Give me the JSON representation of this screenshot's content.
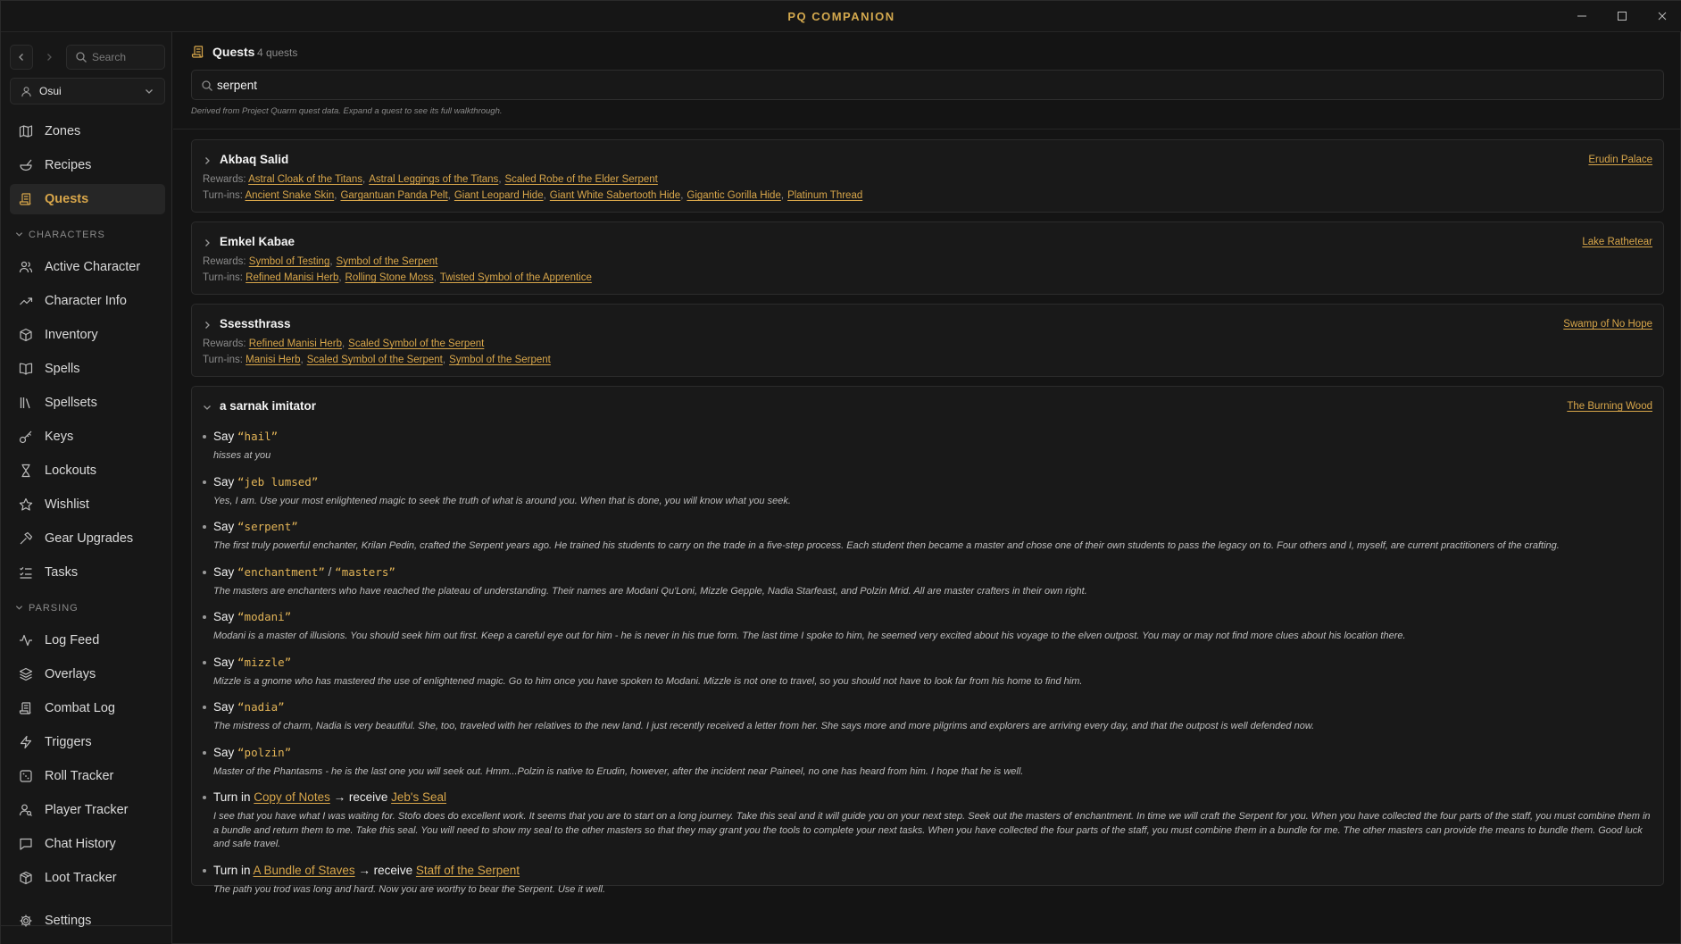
{
  "app": {
    "title": "PQ COMPANION"
  },
  "window_controls": {
    "minimize": "–",
    "maximize": "☐",
    "close": "✕"
  },
  "sidebar": {
    "back": "‹",
    "forward": "›",
    "search_placeholder": "Search",
    "character": "Osui",
    "items": [
      {
        "id": "zones",
        "label": "Zones",
        "icon": "map-icon"
      },
      {
        "id": "recipes",
        "label": "Recipes",
        "icon": "mortar-pestle-icon"
      },
      {
        "id": "quests",
        "label": "Quests",
        "icon": "scroll-icon",
        "active": true
      }
    ],
    "sections": [
      {
        "title": "CHARACTERS",
        "items": [
          {
            "id": "active-character",
            "label": "Active Character",
            "icon": "users-icon"
          },
          {
            "id": "character-info",
            "label": "Character Info",
            "icon": "trending-up-icon"
          },
          {
            "id": "inventory",
            "label": "Inventory",
            "icon": "box-icon"
          },
          {
            "id": "spells",
            "label": "Spells",
            "icon": "book-icon"
          },
          {
            "id": "spellsets",
            "label": "Spellsets",
            "icon": "library-icon"
          },
          {
            "id": "keys",
            "label": "Keys",
            "icon": "key-icon"
          },
          {
            "id": "lockouts",
            "label": "Lockouts",
            "icon": "hourglass-icon"
          },
          {
            "id": "wishlist",
            "label": "Wishlist",
            "icon": "star-icon"
          },
          {
            "id": "gear-upgrades",
            "label": "Gear Upgrades",
            "icon": "hammer-icon"
          },
          {
            "id": "tasks",
            "label": "Tasks",
            "icon": "list-checks-icon"
          }
        ]
      },
      {
        "title": "PARSING",
        "items": [
          {
            "id": "log-feed",
            "label": "Log Feed",
            "icon": "activity-icon"
          },
          {
            "id": "overlays",
            "label": "Overlays",
            "icon": "layers-icon"
          },
          {
            "id": "combat-log",
            "label": "Combat Log",
            "icon": "scroll-icon"
          },
          {
            "id": "triggers",
            "label": "Triggers",
            "icon": "zap-icon"
          },
          {
            "id": "roll-tracker",
            "label": "Roll Tracker",
            "icon": "dice-icon"
          },
          {
            "id": "player-tracker",
            "label": "Player Tracker",
            "icon": "user-search-icon"
          },
          {
            "id": "chat-history",
            "label": "Chat History",
            "icon": "message-icon"
          },
          {
            "id": "loot-tracker",
            "label": "Loot Tracker",
            "icon": "package-icon"
          }
        ]
      }
    ],
    "settings": {
      "label": "Settings",
      "icon": "gear-icon"
    }
  },
  "main": {
    "title": "Quests",
    "count": "4 quests",
    "search_value": "serpent",
    "footnote": "Derived from Project Quarm quest data. Expand a quest to see its full walkthrough.",
    "rewards_label": "Rewards:",
    "turnins_label": "Turn-ins:",
    "say_label": "Say",
    "turnin_label": "Turn in",
    "receive_label": "→ receive",
    "quests": [
      {
        "name": "Akbaq Salid",
        "zone": "Erudin Palace",
        "expanded": false,
        "rewards": [
          "Astral Cloak of the Titans",
          "Astral Leggings of the Titans",
          "Scaled Robe of the Elder Serpent"
        ],
        "turnins": [
          "Ancient Snake Skin",
          "Gargantuan Panda Pelt",
          "Giant Leopard Hide",
          "Giant White Sabertooth Hide",
          "Gigantic Gorilla Hide",
          "Platinum Thread"
        ]
      },
      {
        "name": "Emkel Kabae",
        "zone": "Lake Rathetear",
        "expanded": false,
        "rewards": [
          "Symbol of Testing",
          "Symbol of the Serpent"
        ],
        "turnins": [
          "Refined Manisi Herb",
          "Rolling Stone Moss",
          "Twisted Symbol of the Apprentice"
        ]
      },
      {
        "name": "Ssessthrass",
        "zone": "Swamp of No Hope",
        "expanded": false,
        "rewards": [
          "Refined Manisi Herb",
          "Scaled Symbol of the Serpent"
        ],
        "turnins": [
          "Manisi Herb",
          "Scaled Symbol of the Serpent",
          "Symbol of the Serpent"
        ]
      },
      {
        "name": "a sarnak imitator",
        "zone": "The Burning Wood",
        "expanded": true,
        "steps": [
          {
            "type": "say",
            "phrases": [
              "“hail”"
            ],
            "response": "hisses at you"
          },
          {
            "type": "say",
            "phrases": [
              "“jeb lumsed”"
            ],
            "response": "Yes, I am. Use your most enlightened magic to seek the truth of what is around you. When that is done, you will know what you seek."
          },
          {
            "type": "say",
            "phrases": [
              "“serpent”"
            ],
            "response": "The first truly powerful enchanter, Krilan Pedin, crafted the Serpent years ago. He trained his students to carry on the trade in a five-step process. Each student then became a master and chose one of their own students to pass the legacy on to. Four others and I, myself, are current practitioners of the crafting."
          },
          {
            "type": "say",
            "phrases": [
              "“enchantment”",
              "“masters”"
            ],
            "response": "The masters are enchanters who have reached the plateau of understanding. Their names are Modani Qu'Loni, Mizzle Gepple, Nadia Starfeast, and Polzin Mrid. All are master crafters in their own right."
          },
          {
            "type": "say",
            "phrases": [
              "“modani”"
            ],
            "response": "Modani is a master of illusions. You should seek him out first. Keep a careful eye out for him - he is never in his true form. The last time I spoke to him, he seemed very excited about his voyage to the elven outpost. You may or may not find more clues about his location there."
          },
          {
            "type": "say",
            "phrases": [
              "“mizzle”"
            ],
            "response": "Mizzle is a gnome who has mastered the use of enlightened magic. Go to him once you have spoken to Modani. Mizzle is not one to travel, so you should not have to look far from his home to find him."
          },
          {
            "type": "say",
            "phrases": [
              "“nadia”"
            ],
            "response": "The mistress of charm, Nadia is very beautiful. She, too, traveled with her relatives to the new land. I just recently received a letter from her. She says more and more pilgrims and explorers are arriving every day, and that the outpost is well defended now."
          },
          {
            "type": "say",
            "phrases": [
              "“polzin”"
            ],
            "response": "Master of the Phantasms - he is the last one you will seek out. Hmm...Polzin is native to Erudin, however, after the incident near Paineel, no one has heard from him. I hope that he is well."
          },
          {
            "type": "turnin",
            "give": "Copy of Notes",
            "receive": "Jeb's Seal",
            "response": "I see that you have what I was waiting for. Stofo does do excellent work. It seems that you are to start on a long journey. Take this seal and it will guide you on your next step. Seek out the masters of enchantment. In time we will craft the Serpent for you. When you have collected the four parts of the staff, you must combine them in a bundle and return them to me. Take this seal. You will need to show my seal to the other masters so that they may grant you the tools to complete your next tasks. When you have collected the four parts of the staff, you must combine them in a bundle for me. The other masters can provide the means to bundle them. Good luck and safe travel."
          },
          {
            "type": "turnin",
            "give": "A Bundle of Staves",
            "receive": "Staff of the Serpent",
            "response": "The path you trod was long and hard. Now you are worthy to bear the Serpent. Use it well."
          }
        ]
      }
    ]
  },
  "colors": {
    "accent": "#d8a64a",
    "background": "#141414",
    "sidebar": "#171717",
    "card": "#191919"
  }
}
